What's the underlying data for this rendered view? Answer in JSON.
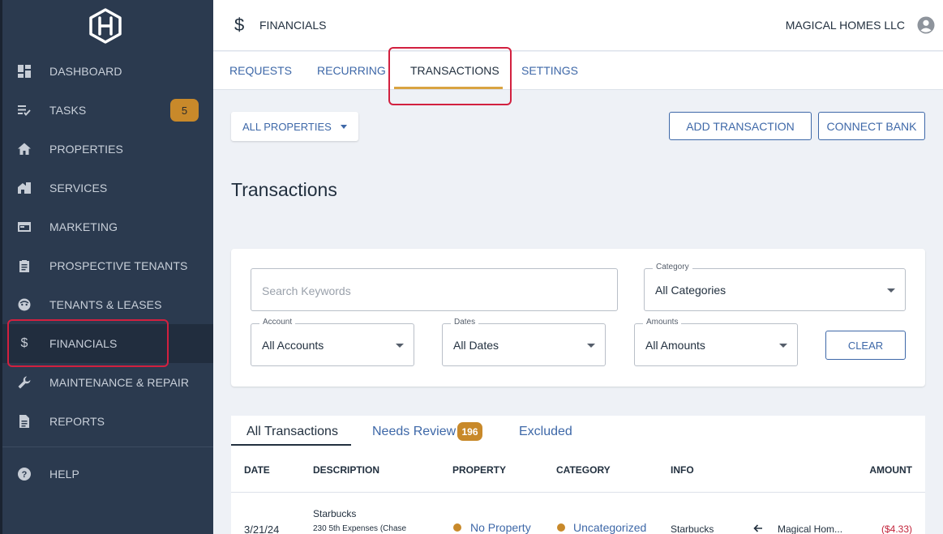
{
  "sidebar": {
    "items": [
      {
        "label": "DASHBOARD",
        "icon": "dashboard-icon"
      },
      {
        "label": "TASKS",
        "icon": "tasks-icon",
        "badge": "5"
      },
      {
        "label": "PROPERTIES",
        "icon": "home-icon"
      },
      {
        "label": "SERVICES",
        "icon": "services-icon"
      },
      {
        "label": "MARKETING",
        "icon": "marketing-icon"
      },
      {
        "label": "PROSPECTIVE TENANTS",
        "icon": "clipboard-icon"
      },
      {
        "label": "TENANTS & LEASES",
        "icon": "tenant-face-icon"
      },
      {
        "label": "FINANCIALS",
        "icon": "dollar-icon",
        "active": true
      },
      {
        "label": "MAINTENANCE & REPAIR",
        "icon": "wrench-icon"
      },
      {
        "label": "REPORTS",
        "icon": "report-icon"
      }
    ],
    "help": {
      "label": "HELP",
      "icon": "help-icon"
    }
  },
  "header": {
    "icon": "dollar-icon",
    "title": "FINANCIALS",
    "company": "MAGICAL HOMES LLC",
    "avatar_icon": "account-circle-icon"
  },
  "tabs": [
    {
      "label": "REQUESTS"
    },
    {
      "label": "RECURRING"
    },
    {
      "label": "TRANSACTIONS",
      "active": true
    },
    {
      "label": "SETTINGS"
    }
  ],
  "toolbar": {
    "property_filter": "ALL PROPERTIES",
    "add_transaction": "ADD TRANSACTION",
    "connect_bank": "CONNECT BANK"
  },
  "page_title": "Transactions",
  "filters": {
    "search_placeholder": "Search Keywords",
    "category": {
      "label": "Category",
      "value": "All Categories"
    },
    "account": {
      "label": "Account",
      "value": "All Accounts"
    },
    "dates": {
      "label": "Dates",
      "value": "All Dates"
    },
    "amounts": {
      "label": "Amounts",
      "value": "All Amounts"
    },
    "clear": "CLEAR"
  },
  "results": {
    "tabs": [
      {
        "label": "All Transactions",
        "active": true
      },
      {
        "label": "Needs Review",
        "badge": "196"
      },
      {
        "label": "Excluded"
      }
    ],
    "columns": [
      "DATE",
      "DESCRIPTION",
      "PROPERTY",
      "CATEGORY",
      "INFO",
      "AMOUNT"
    ],
    "rows": [
      {
        "date": "3/21/24",
        "description": "Starbucks",
        "description_sub": "230 5th Expenses (Chase",
        "property": "No Property",
        "category": "Uncategorized",
        "info": "Starbucks",
        "direction_icon": "arrow-left-icon",
        "account": "Magical Hom...",
        "amount": "($4.33)"
      }
    ]
  },
  "colors": {
    "sidebar_bg": "#2b3a4f",
    "accent_gold": "#c8892a",
    "link_blue": "#3e68a8",
    "highlight_red": "#d2203f",
    "negative_red": "#c3243b"
  }
}
